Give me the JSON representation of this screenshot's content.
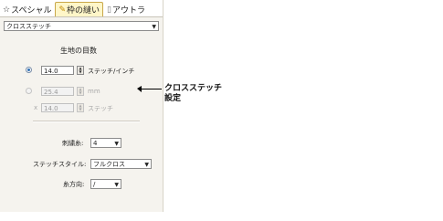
{
  "tabs": [
    {
      "label": "スペシャル",
      "icon": "star-icon",
      "active": false
    },
    {
      "label": "枠の縫い",
      "icon": "hoop-icon",
      "active": true
    },
    {
      "label": "アウトラ",
      "icon": "thread-icon",
      "active": false
    }
  ],
  "stitch_type": {
    "value": "クロスステッチ"
  },
  "fabric_count": {
    "heading": "生地の目数",
    "per_inch": {
      "value": "14.0",
      "unit": "ステッチ/インチ",
      "selected": true
    },
    "mm": {
      "value": "25.4",
      "unit": "mm",
      "selected": false
    },
    "stitches": {
      "value": "14.0",
      "unit": "ステッチ",
      "prefix": "x"
    }
  },
  "strands": {
    "label": "刺繍糸:",
    "value": "4"
  },
  "stitch_style": {
    "label": "ステッチスタイル:",
    "value": "フルクロス"
  },
  "thread_direction": {
    "label": "糸方向:",
    "value": "/"
  },
  "callout": {
    "line1": "クロスステッチ",
    "line2": "設定"
  }
}
